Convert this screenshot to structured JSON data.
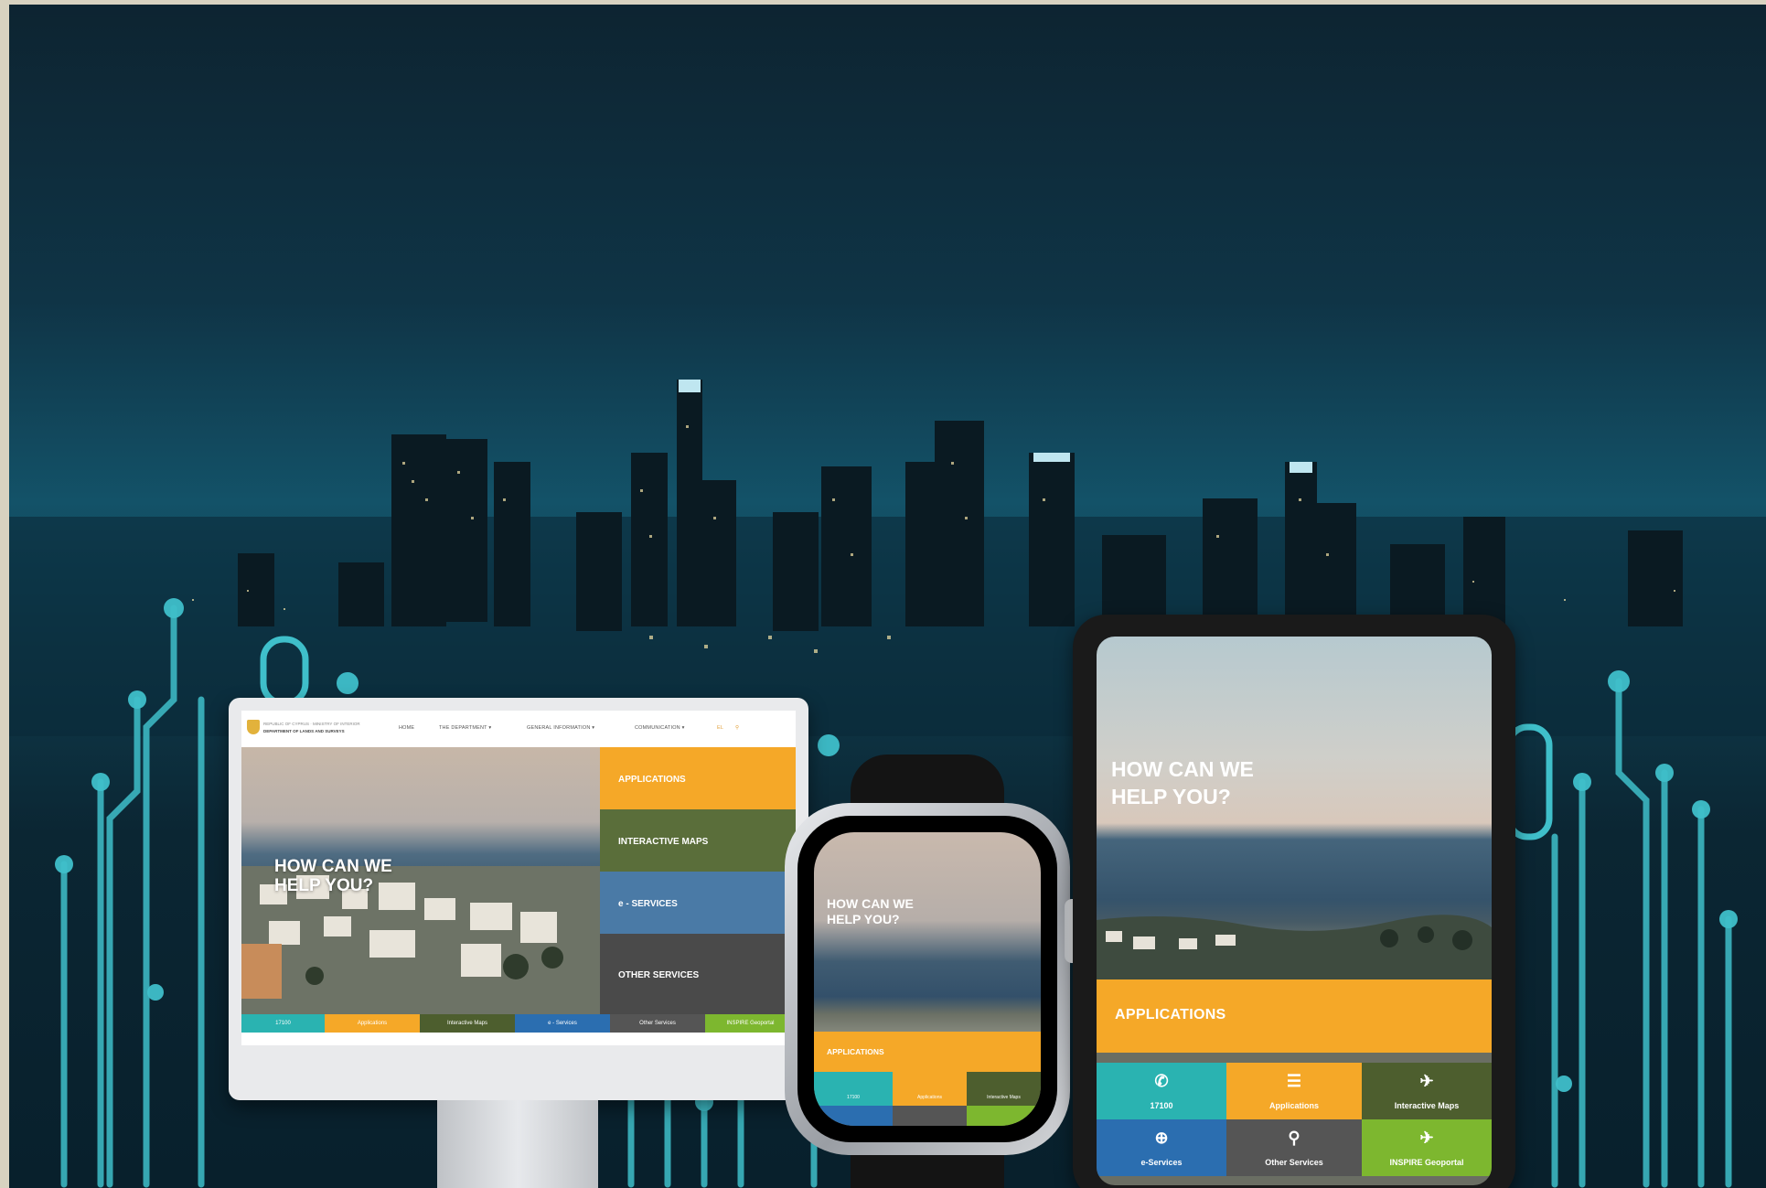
{
  "desktop": {
    "org_line1": "REPUBLIC OF CYPRUS · MINISTRY OF INTERIOR",
    "org_line2": "DEPARTMENT OF LANDS AND SURVEYS",
    "nav": [
      "HOME",
      "THE DEPARTMENT ▾",
      "GENERAL INFORMATION ▾",
      "COMMUNICATION ▾"
    ],
    "lang": "EL",
    "hero_title": "HOW CAN WE HELP YOU?",
    "tiles": [
      {
        "label": "APPLICATIONS",
        "color": "#f5a828"
      },
      {
        "label": "INTERACTIVE MAPS",
        "color": "#5a6e3a"
      },
      {
        "label": "e - SERVICES",
        "color": "#4a7aa6"
      },
      {
        "label": "OTHER SERVICES",
        "color": "#4a4a4a"
      }
    ],
    "strip": [
      {
        "label": "17100",
        "color": "#2ab3b1"
      },
      {
        "label": "Applications",
        "color": "#f5a828"
      },
      {
        "label": "Interactive Maps",
        "color": "#4d5e2e"
      },
      {
        "label": "e - Services",
        "color": "#2b6eb0"
      },
      {
        "label": "Other Services",
        "color": "#555555"
      },
      {
        "label": "INSPIRE Geoportal",
        "color": "#7db72f"
      }
    ]
  },
  "watch": {
    "hero_title": "HOW CAN WE HELP YOU?",
    "applications": "APPLICATIONS",
    "cells": [
      {
        "label": "17100",
        "color": "#2ab3b1"
      },
      {
        "label": "Applications",
        "color": "#f5a828"
      },
      {
        "label": "Interactive Maps",
        "color": "#4d5e2e"
      },
      {
        "label": "",
        "color": "#2b6eb0"
      },
      {
        "label": "",
        "color": "#555555"
      },
      {
        "label": "",
        "color": "#7db72f"
      }
    ]
  },
  "tablet": {
    "hero_title": "HOW CAN WE HELP YOU?",
    "applications": "APPLICATIONS",
    "cells": [
      {
        "label": "17100",
        "icon": "phone-icon",
        "glyph": "✆",
        "color": "#2ab3b1"
      },
      {
        "label": "Applications",
        "icon": "document-icon",
        "glyph": "☰",
        "color": "#f5a828"
      },
      {
        "label": "Interactive Maps",
        "icon": "map-icon",
        "glyph": "✈",
        "color": "#4d5e2e"
      },
      {
        "label": "e-Services",
        "icon": "globe-icon",
        "glyph": "⊕",
        "color": "#2b6eb0"
      },
      {
        "label": "Other Services",
        "icon": "services-icon",
        "glyph": "⚲",
        "color": "#555555"
      },
      {
        "label": "INSPIRE Geoportal",
        "icon": "geoportal-icon",
        "glyph": "✈",
        "color": "#7db72f"
      }
    ]
  }
}
